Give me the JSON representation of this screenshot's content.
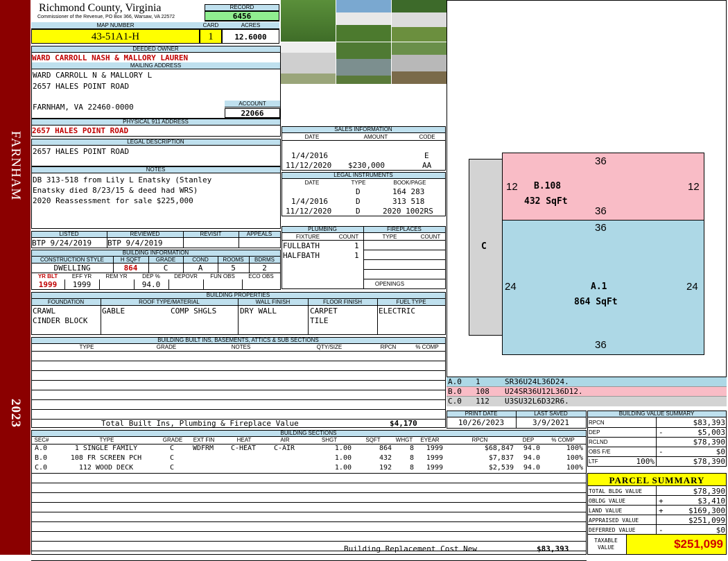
{
  "sidebar": {
    "town": "FARNHAM",
    "year": "2023"
  },
  "header": {
    "county": "Richmond County, Virginia",
    "commissioner": "Commissioner of the Revenue, PO Box 366, Warsaw, VA 22572",
    "record_label": "RECORD",
    "record": "6456",
    "map_label": "MAP NUMBER",
    "map": "43-51A1-H",
    "card_label": "CARD",
    "card": "1",
    "acres_label": "ACRES",
    "acres": "12.6000"
  },
  "owner": {
    "deeded_label": "DEEDED OWNER",
    "deeded": "WARD CARROLL NASH & MALLORY LAUREN",
    "mailing_label": "MAILING ADDRESS",
    "mail1": "WARD CARROLL N & MALLORY L",
    "mail2": "2657 HALES POINT ROAD",
    "mail3": "FARNHAM, VA 22460-0000",
    "account_label": "ACCOUNT",
    "account": "22066",
    "physical_label": "PHYSICAL 911 ADDRESS",
    "physical": "2657 HALES POINT ROAD",
    "legal_label": "LEGAL DESCRIPTION",
    "legal": "2657 HALES POINT ROAD",
    "notes_label": "NOTES",
    "notes1": "DB 313-518 from Lily L Enatsky (Stanley",
    "notes2": "Enatsky died 8/23/15 & deed had WRS)",
    "notes3": "2020 Reassessment for sale $225,000"
  },
  "listing": {
    "listed_label": "LISTED",
    "listed": "BTP  9/24/2019",
    "reviewed_label": "REVIEWED",
    "reviewed": "BTP  9/4/2019",
    "revisit_label": "REVISIT",
    "appeals_label": "APPEALS"
  },
  "building_info": {
    "label": "BUILDING INFORMATION",
    "h_style": "CONSTRUCTION STYLE",
    "h_hsqft": "H SQFT",
    "h_grade": "GRADE",
    "h_cond": "COND",
    "h_rooms": "ROOMS",
    "h_bdrms": "BDRMS",
    "style": "DWELLING",
    "hsqft": "864",
    "grade": "C",
    "cond": "A",
    "rooms": "5",
    "bdrms": "2",
    "h_yrblt": "YR BLT",
    "h_effyr": "EFF YR",
    "h_remyr": "REM YR",
    "h_dep": "DEP %",
    "h_depovr": "DEPOVR",
    "h_funobs": "FUN OBS",
    "h_ecoobs": "ECO OBS",
    "yrblt": "1999",
    "effyr": "1999",
    "dep": "94.0"
  },
  "sales": {
    "label": "SALES INFORMATION",
    "h_date": "DATE",
    "h_amount": "AMOUNT",
    "h_code": "CODE",
    "rows": [
      {
        "date": "1/4/2016",
        "amount": "",
        "code": "E"
      },
      {
        "date": "11/12/2020",
        "amount": "$230,000",
        "code": "AA"
      }
    ]
  },
  "instruments": {
    "label": "LEGAL INSTRUMENTS",
    "h_date": "DATE",
    "h_type": "TYPE",
    "h_book": "BOOK/PAGE",
    "rows": [
      {
        "date": "",
        "type": "D",
        "book": "164 283"
      },
      {
        "date": "1/4/2016",
        "type": "D",
        "book": "313 518"
      },
      {
        "date": "11/12/2020",
        "type": "D",
        "book": "2020 1002RS"
      }
    ]
  },
  "plumbing": {
    "label": "PLUMBING",
    "h_fixture": "FIXTURE",
    "h_count": "COUNT",
    "rows": [
      {
        "fixture": "FULLBATH",
        "count": "1"
      },
      {
        "fixture": "HALFBATH",
        "count": "1"
      }
    ]
  },
  "fireplaces": {
    "label": "FIREPLACES",
    "h_type": "TYPE",
    "h_count": "COUNT",
    "openings": "OPENINGS"
  },
  "properties": {
    "label": "BUILDING PROPERTIES",
    "h_found": "FOUNDATION",
    "h_roof": "ROOF TYPE/MATERIAL",
    "h_wall": "WALL FINISH",
    "h_floor": "FLOOR FINISH",
    "h_fuel": "FUEL TYPE",
    "found1": "CRAWL",
    "found2": "CINDER BLOCK",
    "roof1": "GABLE",
    "roof2": "COMP SHGLS",
    "wall": "DRY WALL",
    "floor1": "CARPET",
    "floor2": "TILE",
    "fuel": "ELECTRIC"
  },
  "builtins": {
    "label": "BUILDING BUILT INS, BASEMENTS, ATTICS & SUB SECTIONS",
    "h_type": "TYPE",
    "h_grade": "GRADE",
    "h_notes": "NOTES",
    "h_qty": "QTY/SIZE",
    "h_rpcn": "RPCN",
    "h_comp": "% COMP",
    "total_label": "Total Built Ins, Plumbing & Fireplace Value",
    "total": "$4,170"
  },
  "dates": {
    "print_label": "PRINT DATE",
    "print": "10/26/2023",
    "saved_label": "LAST SAVED",
    "saved": "3/9/2021"
  },
  "sketch": {
    "c_label": "C",
    "b_label": "B.108",
    "b_area": "432 SqFt",
    "a_label": "A.1",
    "a_area": "864 SqFt",
    "d36a": "36",
    "d36b": "36",
    "d36c": "36",
    "d36d": "36",
    "d12l": "12",
    "d12r": "12",
    "d24l": "24",
    "d24r": "24",
    "colors": {
      "b": "#f9bcc6",
      "a": "#add8e6",
      "c": "#d3d3d3"
    }
  },
  "traverse": [
    {
      "sec": "A.0",
      "code": "1",
      "path": "SR36U24L36D24."
    },
    {
      "sec": "B.0",
      "code": "108",
      "path": "U24SR36U12L36D12."
    },
    {
      "sec": "C.0",
      "code": "112",
      "path": "U3SU32L6D32R6."
    }
  ],
  "sections": {
    "label": "BUILDING SECTIONS",
    "headers": [
      "SEC#",
      "TYPE",
      "GRADE",
      "EXT FIN",
      "HEAT",
      "AIR",
      "SHGT",
      "SQFT",
      "WHGT",
      "EYEAR",
      "RPCN",
      "DEP",
      "% COMP"
    ],
    "rows": [
      [
        "A.0",
        "1 SINGLE FAMILY",
        "C",
        "WDFRM",
        "C-HEAT",
        "C-AIR",
        "1.00",
        "864",
        "8",
        "1999",
        "$68,847",
        "94.0",
        "100%"
      ],
      [
        "B.0",
        "108 FR SCREEN PCH",
        "C",
        "",
        "",
        "",
        "1.00",
        "432",
        "8",
        "1999",
        "$7,837",
        "94.0",
        "100%"
      ],
      [
        "C.0",
        "112 WOOD DECK",
        "C",
        "",
        "",
        "",
        "1.00",
        "192",
        "8",
        "1999",
        "$2,539",
        "94.0",
        "100%"
      ]
    ],
    "repl_label": "Building Replacement Cost New",
    "repl": "$83,393"
  },
  "value_summary": {
    "label": "BUILDING VALUE SUMMARY",
    "rpcn_l": "RPCN",
    "rpcn": "$83,393",
    "dep_l": "DEP",
    "dep_s": "-",
    "dep": "$5,003",
    "rclnd_l": "RCLND",
    "rclnd": "$78,390",
    "obs_l": "OBS F/E",
    "obs_s": "-",
    "obs": "$0",
    "ltf_l": "LTF",
    "ltf_p": "100%",
    "ltf": "$78,390"
  },
  "parcel": {
    "label": "PARCEL SUMMARY",
    "tbv_l": "TOTAL BLDG VALUE",
    "tbv": "$78,390",
    "obv_l": "OBLDG VALUE",
    "obv_s": "+",
    "obv": "$3,410",
    "land_l": "LAND VALUE",
    "land_s": "+",
    "land": "$169,300",
    "appr_l": "APPRAISED VALUE",
    "appr": "$251,099",
    "def_l": "DEFERRED VALUE",
    "def_s": "-",
    "def": "$0",
    "tax_l1": "TAXABLE",
    "tax_l2": "VALUE",
    "tax": "$251,099"
  }
}
